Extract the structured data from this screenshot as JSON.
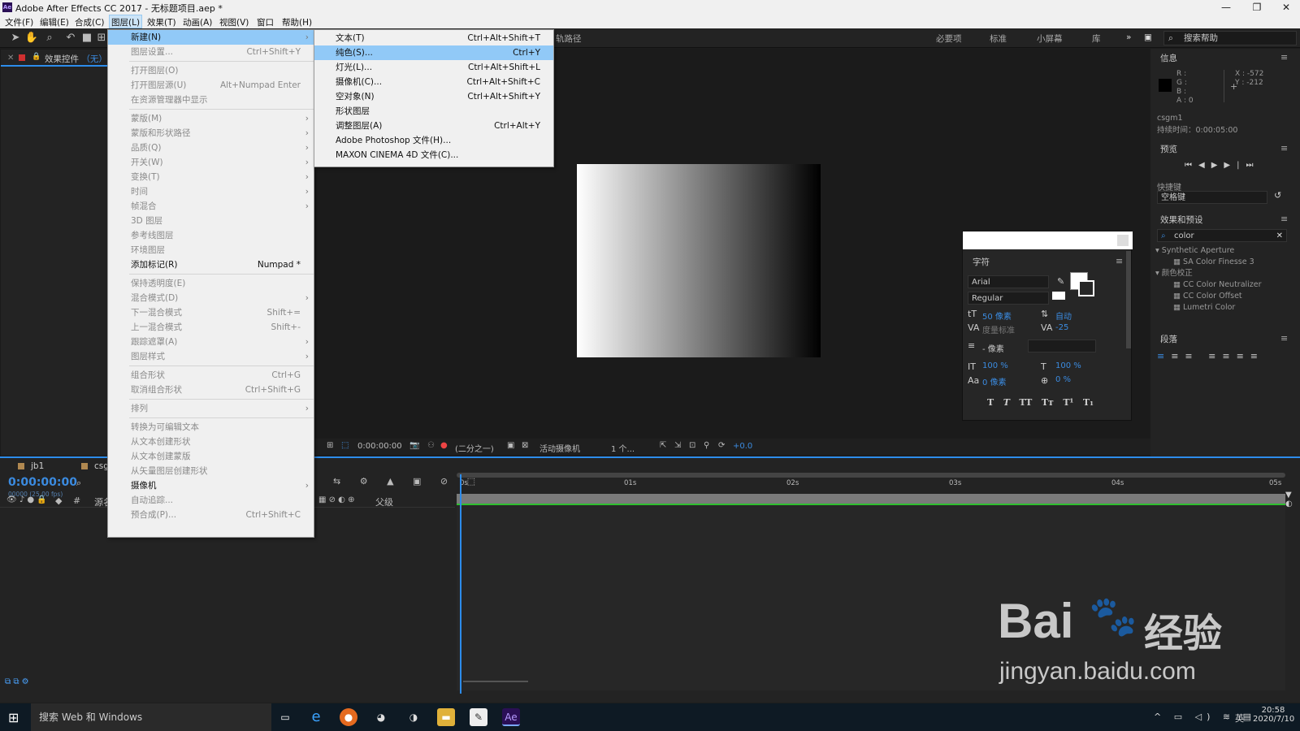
{
  "titlebar": {
    "title": "Adobe After Effects CC 2017 - 无标题项目.aep *",
    "app_icon": "Ae",
    "minimize": "—",
    "maximize": "❐",
    "close": "✕"
  },
  "menubar": [
    "文件(F)",
    "编辑(E)",
    "合成(C)",
    "图层(L)",
    "效果(T)",
    "动画(A)",
    "视图(V)",
    "窗口",
    "帮助(H)"
  ],
  "toolbar": {
    "path_label": "轨路径",
    "workspaces": [
      "必要项",
      "标准",
      "小屏幕",
      "库"
    ],
    "search_help": "搜索帮助"
  },
  "effect_controls": {
    "title": "效果控件",
    "title_value": "（无）"
  },
  "info_panel": {
    "title": "信息",
    "rgba": [
      "R :",
      "G :",
      "B :",
      "A : 0"
    ],
    "x": "X : -572",
    "y": "Y : -212",
    "layer": "csgm1",
    "duration": "持续时间：0:00:05:00"
  },
  "preview_panel": {
    "title": "预览",
    "shortcut_label": "快捷键",
    "shortcut_value": "空格键"
  },
  "effects_presets": {
    "title": "效果和预设",
    "search": "color",
    "groups": [
      {
        "name": "Synthetic Aperture",
        "items": [
          "SA Color Finesse 3"
        ]
      },
      {
        "name": "颜色校正",
        "items": [
          "CC Color Neutralizer",
          "CC Color Offset",
          "Lumetri Color"
        ]
      }
    ]
  },
  "paragraph_panel": {
    "title": "段落"
  },
  "character_panel": {
    "title": "字符",
    "font": "Arial",
    "style": "Regular",
    "size": "50 像素",
    "leading": "自动",
    "kerning": "度量标准",
    "tracking": "-25",
    "stroke": "- 像素",
    "vscale": "100 %",
    "hscale": "100 %",
    "baseline": "0 像素",
    "tsume": "0 %",
    "styles": [
      "T",
      "T",
      "TT",
      "Tт",
      "T¹",
      "T₁"
    ]
  },
  "viewer_bar": {
    "timecode": "0:00:00:00",
    "resolution": "(二分之一)",
    "camera": "活动摄像机",
    "views": "1 个...",
    "exposure": "+0.0"
  },
  "timeline": {
    "tabs": [
      "jb1",
      "csg"
    ],
    "timecode": "0:00:00:00",
    "fps": "00000 (25.00 fps)",
    "ruler": [
      "0s",
      "01s",
      "02s",
      "03s",
      "04s",
      "05s"
    ],
    "col_source": "源名",
    "col_parent": "父级"
  },
  "layer_menu": [
    {
      "label": "新建(N)",
      "shortcut": "",
      "submenu": true,
      "state": "highlight"
    },
    {
      "label": "图层设置...",
      "shortcut": "Ctrl+Shift+Y",
      "state": "disabled"
    },
    {
      "sep": true
    },
    {
      "label": "打开图层(O)",
      "shortcut": "",
      "state": "disabled"
    },
    {
      "label": "打开图层源(U)",
      "shortcut": "Alt+Numpad Enter",
      "state": "disabled"
    },
    {
      "label": "在资源管理器中显示",
      "shortcut": "",
      "state": "disabled"
    },
    {
      "sep": true
    },
    {
      "label": "蒙版(M)",
      "submenu": true,
      "state": "disabled"
    },
    {
      "label": "蒙版和形状路径",
      "submenu": true,
      "state": "disabled"
    },
    {
      "label": "品质(Q)",
      "submenu": true,
      "state": "disabled"
    },
    {
      "label": "开关(W)",
      "submenu": true,
      "state": "disabled"
    },
    {
      "label": "变换(T)",
      "submenu": true,
      "state": "disabled"
    },
    {
      "label": "时间",
      "submenu": true,
      "state": "disabled"
    },
    {
      "label": "帧混合",
      "submenu": true,
      "state": "disabled"
    },
    {
      "label": "3D 图层",
      "state": "disabled"
    },
    {
      "label": "参考线图层",
      "state": "disabled"
    },
    {
      "label": "环境图层",
      "state": "disabled"
    },
    {
      "label": "添加标记(R)",
      "shortcut": "Numpad *",
      "state": "enabled"
    },
    {
      "sep": true
    },
    {
      "label": "保持透明度(E)",
      "state": "disabled"
    },
    {
      "label": "混合模式(D)",
      "submenu": true,
      "state": "disabled"
    },
    {
      "label": "下一混合模式",
      "shortcut": "Shift+=",
      "state": "disabled"
    },
    {
      "label": "上一混合模式",
      "shortcut": "Shift+-",
      "state": "disabled"
    },
    {
      "label": "跟踪遮罩(A)",
      "submenu": true,
      "state": "disabled"
    },
    {
      "label": "图层样式",
      "submenu": true,
      "state": "disabled"
    },
    {
      "sep": true
    },
    {
      "label": "组合形状",
      "shortcut": "Ctrl+G",
      "state": "disabled"
    },
    {
      "label": "取消组合形状",
      "shortcut": "Ctrl+Shift+G",
      "state": "disabled"
    },
    {
      "sep": true
    },
    {
      "label": "排列",
      "submenu": true,
      "state": "disabled"
    },
    {
      "sep": true
    },
    {
      "label": "转换为可编辑文本",
      "state": "disabled"
    },
    {
      "label": "从文本创建形状",
      "state": "disabled"
    },
    {
      "label": "从文本创建蒙版",
      "state": "disabled"
    },
    {
      "label": "从矢量图层创建形状",
      "state": "disabled"
    },
    {
      "label": "摄像机",
      "submenu": true,
      "state": "enabled"
    },
    {
      "label": "自动追踪...",
      "state": "disabled"
    },
    {
      "label": "预合成(P)...",
      "shortcut": "Ctrl+Shift+C",
      "state": "disabled"
    }
  ],
  "new_submenu": [
    {
      "label": "文本(T)",
      "shortcut": "Ctrl+Alt+Shift+T"
    },
    {
      "label": "纯色(S)...",
      "shortcut": "Ctrl+Y",
      "highlight": true
    },
    {
      "label": "灯光(L)...",
      "shortcut": "Ctrl+Alt+Shift+L"
    },
    {
      "label": "摄像机(C)...",
      "shortcut": "Ctrl+Alt+Shift+C"
    },
    {
      "label": "空对象(N)",
      "shortcut": "Ctrl+Alt+Shift+Y"
    },
    {
      "label": "形状图层",
      "shortcut": ""
    },
    {
      "label": "调整图层(A)",
      "shortcut": "Ctrl+Alt+Y"
    },
    {
      "label": "Adobe Photoshop 文件(H)...",
      "shortcut": ""
    },
    {
      "label": "MAXON CINEMA 4D 文件(C)...",
      "shortcut": ""
    }
  ],
  "taskbar": {
    "search": "搜索 Web 和 Windows",
    "time": "20:58",
    "date": "2020/7/10",
    "ime": "英"
  },
  "watermark": {
    "brand": "Bai",
    "cn": "经验",
    "url": "jingyan.baidu.com"
  },
  "colors": {
    "accent": "#2d8ceb",
    "menu_bg": "#f0f0f0",
    "menu_highlight": "#91c9f7",
    "panel_bg": "#232323"
  }
}
